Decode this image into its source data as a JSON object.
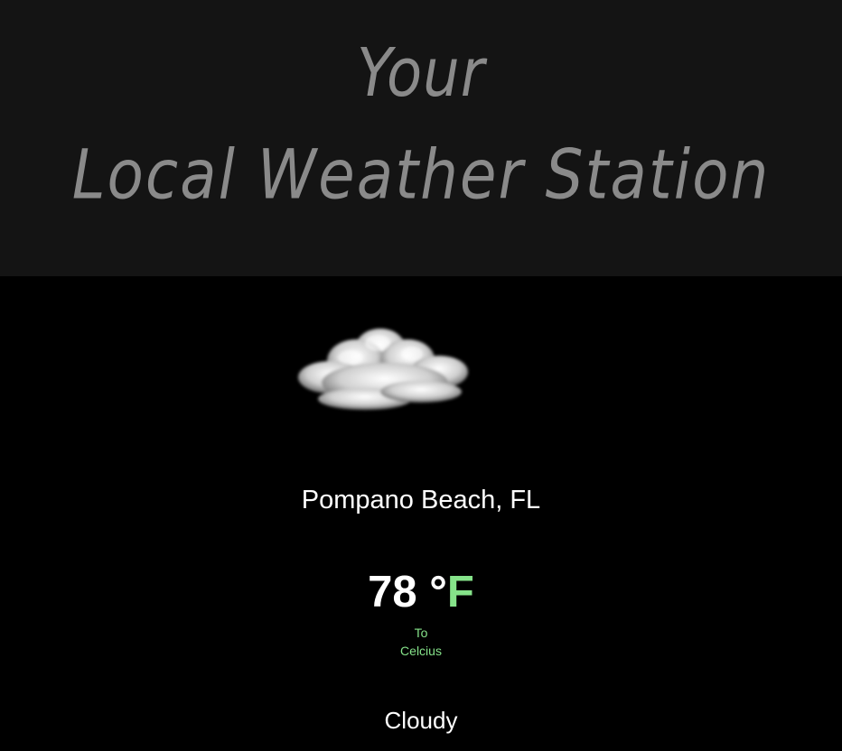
{
  "header": {
    "title_line1": "Your",
    "title_line2": "Local Weather Station"
  },
  "weather": {
    "icon": "cloud-icon",
    "location": "Pompano Beach, FL",
    "temperature": "78",
    "degree_symbol": "°",
    "unit": "F",
    "toggle_line1": "To",
    "toggle_line2": "Celcius",
    "condition": "Cloudy"
  },
  "colors": {
    "header_bg": "#141414",
    "page_bg": "#000000",
    "title_text": "#8a8a8a",
    "accent_green": "#86e38a",
    "text": "#ffffff"
  }
}
